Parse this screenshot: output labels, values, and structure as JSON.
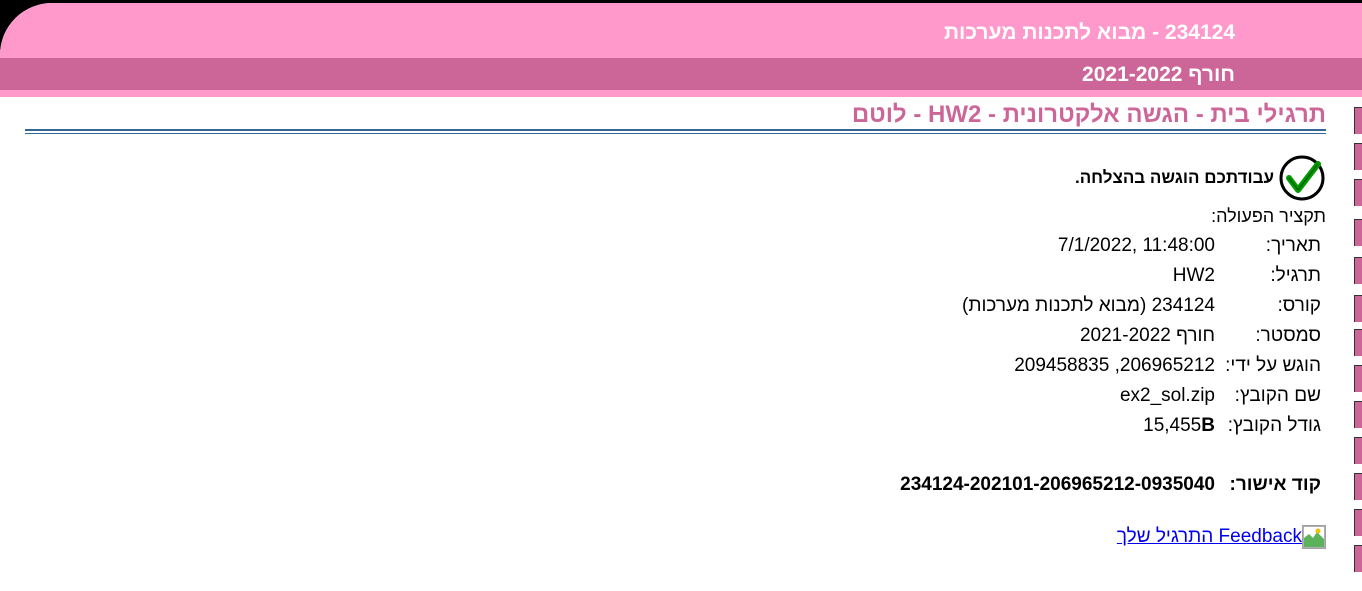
{
  "header": {
    "course_title": "234124 - מבוא לתכנות מערכות",
    "semester_title": "חורף 2021-2022"
  },
  "page": {
    "heading": "תרגילי בית - הגשה אלקטרונית - HW2 - לוטם",
    "success_message": "עבודתכם הוגשה בהצלחה.",
    "summary_label": "תקציר הפעולה:"
  },
  "info": {
    "rows": [
      {
        "label": "תאריך:",
        "value": "7/1/2022, 11:48:00"
      },
      {
        "label": "תרגיל:",
        "value": "HW2"
      },
      {
        "label": "קורס:",
        "value": "234124 (מבוא לתכנות מערכות)"
      },
      {
        "label": "סמסטר:",
        "value": "חורף 2021-2022"
      },
      {
        "label": "הוגש על ידי:",
        "value": "206965212, 209458835"
      },
      {
        "label": "שם הקובץ:",
        "value": "ex2_sol.zip"
      }
    ],
    "file_size_label": "גודל הקובץ:",
    "file_size_number": "15,455",
    "file_size_unit": "B"
  },
  "approval": {
    "label": "קוד אישור:",
    "code": "234124-202101-206965212-0935040"
  },
  "feedback": {
    "link_text": "Feedback התרגיל שלך"
  },
  "colors": {
    "header_pink": "#ff99cc",
    "header_dark_pink": "#cc6699",
    "heading_pink": "#cc6699",
    "rule_blue": "#336699",
    "link_blue": "#0000ee",
    "check_green": "#009900"
  },
  "icons": {
    "success": "checkmark-circle-icon",
    "feedback": "broken-image-icon"
  }
}
